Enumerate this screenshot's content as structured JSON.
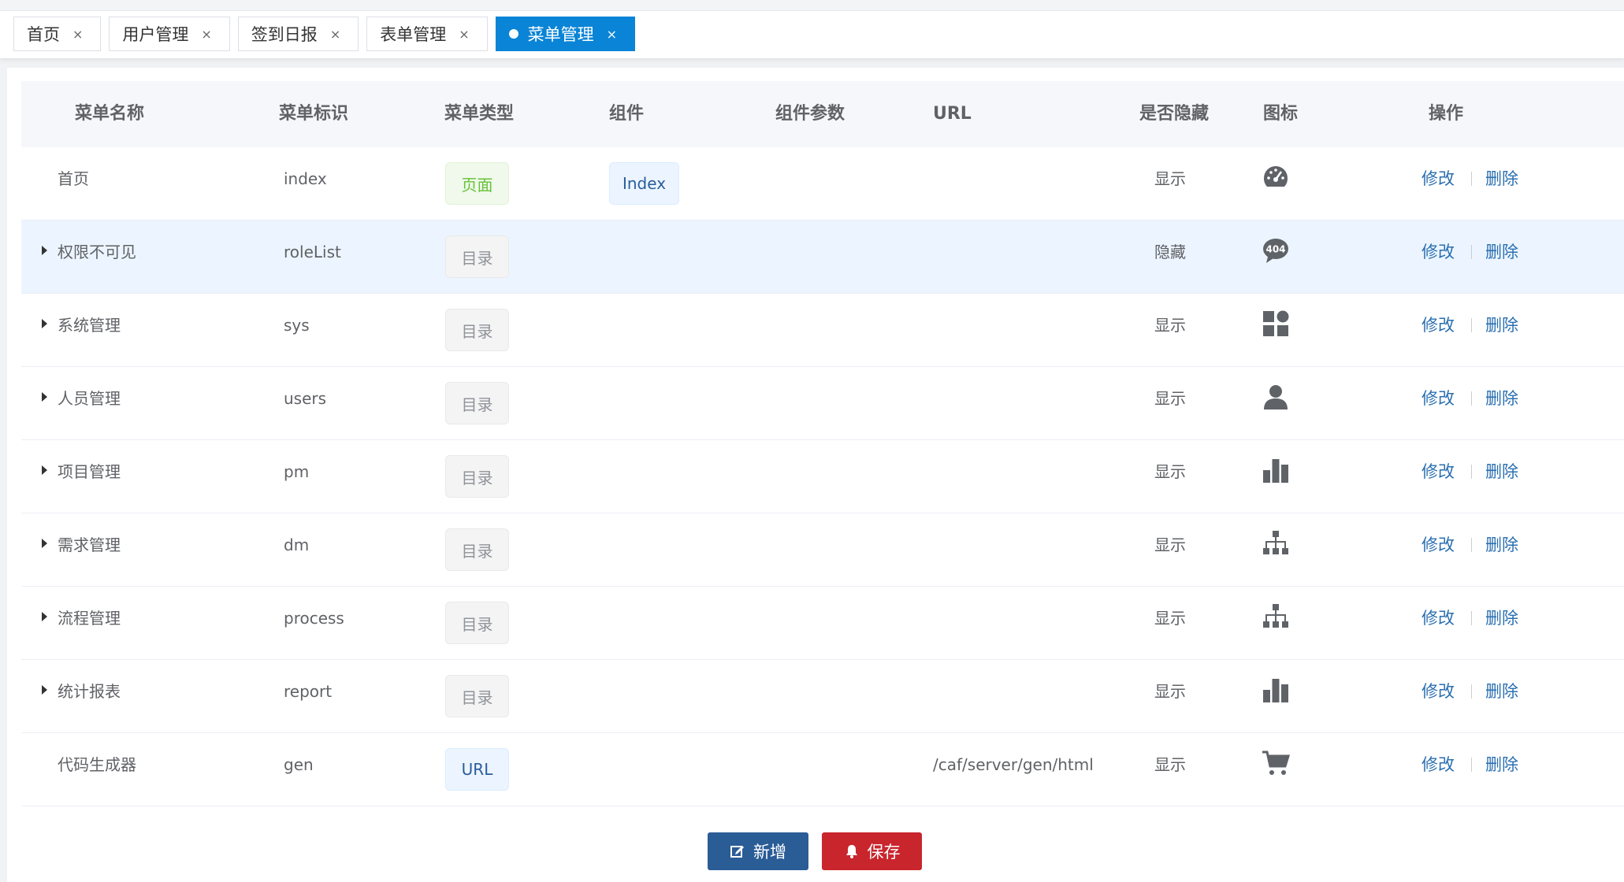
{
  "tabs": [
    {
      "label": "首页",
      "close": "×",
      "active": false
    },
    {
      "label": "用户管理",
      "close": "×",
      "active": false
    },
    {
      "label": "签到日报",
      "close": "×",
      "active": false
    },
    {
      "label": "表单管理",
      "close": "×",
      "active": false
    },
    {
      "label": "菜单管理",
      "close": "×",
      "active": true
    }
  ],
  "table": {
    "headers": {
      "name": "菜单名称",
      "key": "菜单标识",
      "type": "菜单类型",
      "component": "组件",
      "params": "组件参数",
      "url": "URL",
      "hidden": "是否隐藏",
      "icon": "图标",
      "ops": "操作"
    },
    "rows": [
      {
        "name": "首页",
        "key": "index",
        "type": "页面",
        "type_style": "page",
        "component": "Index",
        "url": "",
        "hidden": "显示",
        "icon": "dashboard-icon",
        "expandable": false,
        "highlighted": false
      },
      {
        "name": "权限不可见",
        "key": "roleList",
        "type": "目录",
        "type_style": "dir",
        "component": "",
        "url": "",
        "hidden": "隐藏",
        "icon": "404-icon",
        "expandable": true,
        "highlighted": true
      },
      {
        "name": "系统管理",
        "key": "sys",
        "type": "目录",
        "type_style": "dir",
        "component": "",
        "url": "",
        "hidden": "显示",
        "icon": "widgets-icon",
        "expandable": true,
        "highlighted": false
      },
      {
        "name": "人员管理",
        "key": "users",
        "type": "目录",
        "type_style": "dir",
        "component": "",
        "url": "",
        "hidden": "显示",
        "icon": "user-icon",
        "expandable": true,
        "highlighted": false
      },
      {
        "name": "项目管理",
        "key": "pm",
        "type": "目录",
        "type_style": "dir",
        "component": "",
        "url": "",
        "hidden": "显示",
        "icon": "bar-chart-icon",
        "expandable": true,
        "highlighted": false
      },
      {
        "name": "需求管理",
        "key": "dm",
        "type": "目录",
        "type_style": "dir",
        "component": "",
        "url": "",
        "hidden": "显示",
        "icon": "sitemap-icon",
        "expandable": true,
        "highlighted": false
      },
      {
        "name": "流程管理",
        "key": "process",
        "type": "目录",
        "type_style": "dir",
        "component": "",
        "url": "",
        "hidden": "显示",
        "icon": "sitemap-icon",
        "expandable": true,
        "highlighted": false
      },
      {
        "name": "统计报表",
        "key": "report",
        "type": "目录",
        "type_style": "dir",
        "component": "",
        "url": "",
        "hidden": "显示",
        "icon": "bar-chart-icon",
        "expandable": true,
        "highlighted": false
      },
      {
        "name": "代码生成器",
        "key": "gen",
        "type": "URL",
        "type_style": "url",
        "component": "",
        "url": "/caf/server/gen/html",
        "hidden": "显示",
        "icon": "cart-icon",
        "expandable": false,
        "highlighted": false
      }
    ],
    "edit_label": "修改",
    "delete_label": "删除"
  },
  "buttons": {
    "add": "新增",
    "save": "保存"
  },
  "colors": {
    "active_tab": "#0a84d6",
    "add_button": "#2a5c96",
    "save_button": "#c9252d",
    "link": "#2a6fb0",
    "row_highlight": "#ecf5ff"
  }
}
